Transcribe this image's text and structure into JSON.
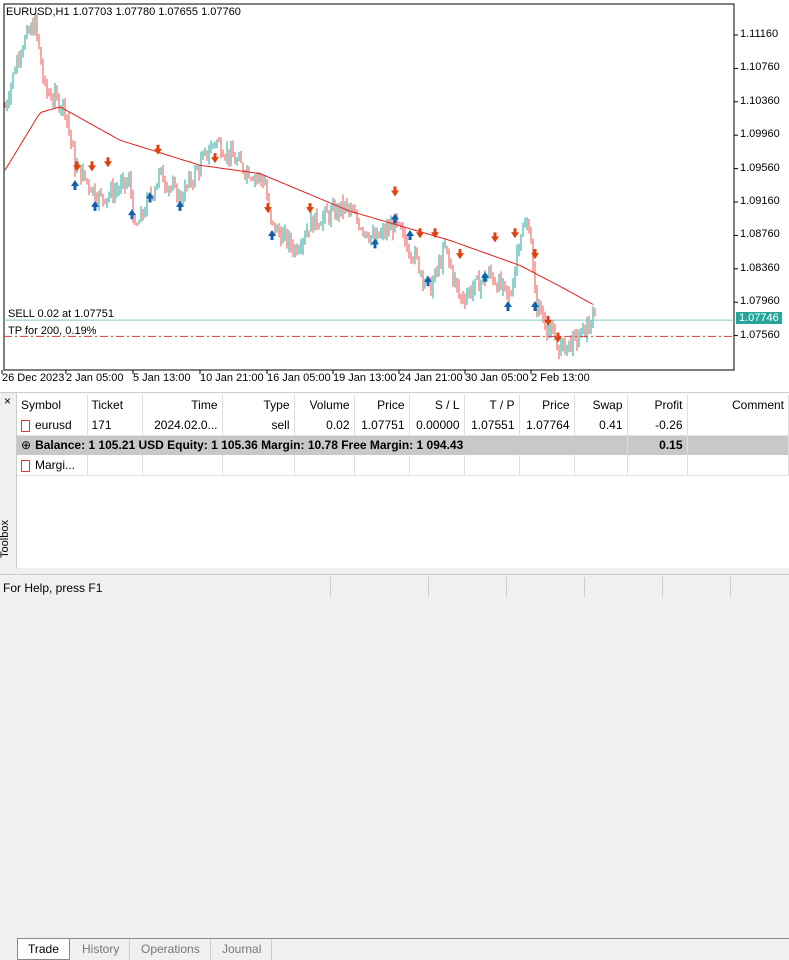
{
  "chart": {
    "title": "EURUSD,H1  1.07703 1.07780 1.07655 1.07760",
    "price_axis": [
      "1.11160",
      "1.10760",
      "1.10360",
      "1.09960",
      "1.09560",
      "1.09160",
      "1.08760",
      "1.08360",
      "1.07960",
      "1.07560"
    ],
    "current_price": "1.07746",
    "time_axis": [
      "26 Dec 2023",
      "2 Jan 05:00",
      "5 Jan 13:00",
      "10 Jan 21:00",
      "16 Jan 05:00",
      "19 Jan 13:00",
      "24 Jan 21:00",
      "30 Jan 05:00",
      "2 Feb 13:00"
    ],
    "sell_line_label": "SELL 0.02 at 1.07751",
    "tp_line_label": "TP for 200, 0.19%",
    "colors": {
      "bull": "#26a69a",
      "bear": "#ef5350",
      "ma": "#e02020",
      "sell_line": "#7ec8c8",
      "tp_line": "#d04040",
      "buy_arrow": "#1060b0",
      "sell_arrow": "#e04010"
    }
  },
  "toolbox": {
    "title": "Toolbox",
    "columns": [
      "Symbol",
      "Ticket",
      "Time",
      "Type",
      "Volume",
      "Price",
      "S / L",
      "T / P",
      "Price",
      "Swap",
      "Profit",
      "Comment"
    ],
    "rows": [
      {
        "symbol": "eurusd",
        "ticket": "171",
        "time": "2024.02.0...",
        "type": "sell",
        "volume": "0.02",
        "price": "1.07751",
        "sl": "0.00000",
        "tp": "1.07551",
        "cur_price": "1.07764",
        "swap": "0.41",
        "profit": "-0.26",
        "comment": ""
      }
    ],
    "summary": {
      "text": "Balance: 1 105.21 USD  Equity: 1 105.36  Margin: 10.78  Free Margin: 1 094.43",
      "profit": "0.15"
    },
    "margin_row": "Margi...",
    "tabs": [
      "Trade",
      "History",
      "Operations",
      "Journal"
    ]
  },
  "status": {
    "help": "For Help, press F1"
  }
}
